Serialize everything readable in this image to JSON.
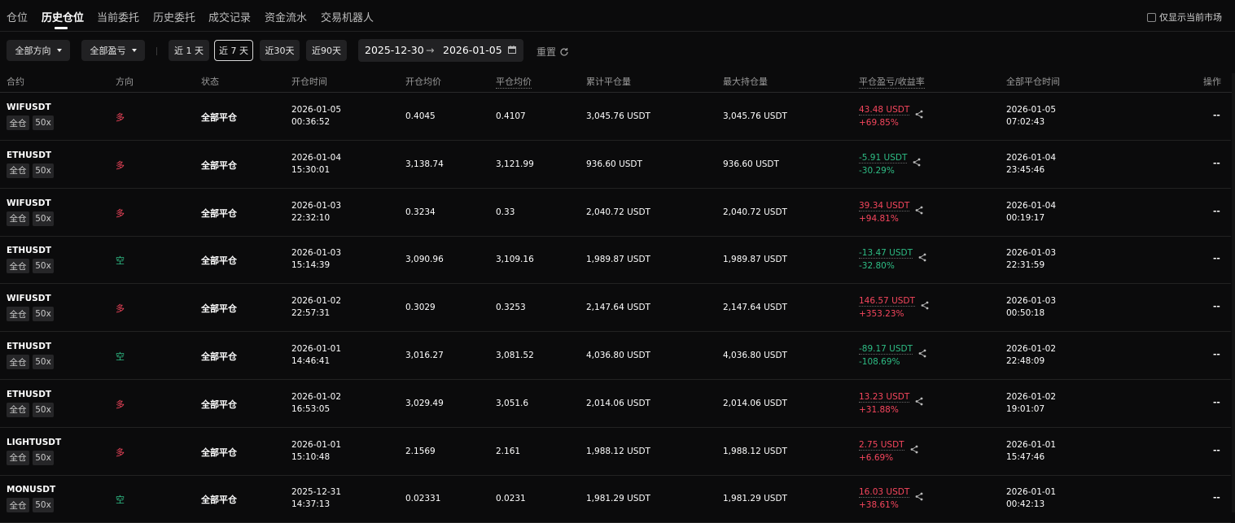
{
  "tabs": [
    "仓位",
    "历史仓位",
    "当前委托",
    "历史委托",
    "成交记录",
    "资金流水",
    "交易机器人"
  ],
  "active_tab": "历史仓位",
  "only_current_label": "仅显示当前市场",
  "filters": {
    "direction": "全部方向",
    "pnl": "全部盈亏",
    "ranges": [
      "近 1 天",
      "近 7 天",
      "近30天",
      "近90天"
    ],
    "selected_range": "近 7 天",
    "date_start": "2025-12-30",
    "date_arrow": "→",
    "date_end": "2026-01-05",
    "reset": "重置"
  },
  "columns": [
    "合约",
    "方向",
    "状态",
    "开仓时间",
    "开仓均价",
    "平仓均价",
    "累计平仓量",
    "最大持仓量",
    "平仓盈亏/收益率",
    "全部平仓时间",
    "操作"
  ],
  "rows": [
    {
      "symbol": "WIFUSDT",
      "margin": "全仓",
      "leverage": "50x",
      "direction": "多",
      "dir_type": "long",
      "status": "全部平仓",
      "open_date": "2026-01-05",
      "open_time": "00:36:52",
      "open_price": "0.4045",
      "close_price": "0.4107",
      "closed_vol": "3,045.76 USDT",
      "max_pos": "3,045.76 USDT",
      "pnl": "43.48 USDT",
      "roi": "+69.85%",
      "pnl_sign": "up",
      "close_date": "2026-01-05",
      "close_time": "07:02:43",
      "ops": "--"
    },
    {
      "symbol": "ETHUSDT",
      "margin": "全仓",
      "leverage": "50x",
      "direction": "多",
      "dir_type": "long",
      "status": "全部平仓",
      "open_date": "2026-01-04",
      "open_time": "15:30:01",
      "open_price": "3,138.74",
      "close_price": "3,121.99",
      "closed_vol": "936.60 USDT",
      "max_pos": "936.60 USDT",
      "pnl": "-5.91 USDT",
      "roi": "-30.29%",
      "pnl_sign": "dn",
      "close_date": "2026-01-04",
      "close_time": "23:45:46",
      "ops": "--"
    },
    {
      "symbol": "WIFUSDT",
      "margin": "全仓",
      "leverage": "50x",
      "direction": "多",
      "dir_type": "long",
      "status": "全部平仓",
      "open_date": "2026-01-03",
      "open_time": "22:32:10",
      "open_price": "0.3234",
      "close_price": "0.33",
      "closed_vol": "2,040.72 USDT",
      "max_pos": "2,040.72 USDT",
      "pnl": "39.34 USDT",
      "roi": "+94.81%",
      "pnl_sign": "up",
      "close_date": "2026-01-04",
      "close_time": "00:19:17",
      "ops": "--"
    },
    {
      "symbol": "ETHUSDT",
      "margin": "全仓",
      "leverage": "50x",
      "direction": "空",
      "dir_type": "short",
      "status": "全部平仓",
      "open_date": "2026-01-03",
      "open_time": "15:14:39",
      "open_price": "3,090.96",
      "close_price": "3,109.16",
      "closed_vol": "1,989.87 USDT",
      "max_pos": "1,989.87 USDT",
      "pnl": "-13.47 USDT",
      "roi": "-32.80%",
      "pnl_sign": "dn",
      "close_date": "2026-01-03",
      "close_time": "22:31:59",
      "ops": "--"
    },
    {
      "symbol": "WIFUSDT",
      "margin": "全仓",
      "leverage": "50x",
      "direction": "多",
      "dir_type": "long",
      "status": "全部平仓",
      "open_date": "2026-01-02",
      "open_time": "22:57:31",
      "open_price": "0.3029",
      "close_price": "0.3253",
      "closed_vol": "2,147.64 USDT",
      "max_pos": "2,147.64 USDT",
      "pnl": "146.57 USDT",
      "roi": "+353.23%",
      "pnl_sign": "up",
      "close_date": "2026-01-03",
      "close_time": "00:50:18",
      "ops": "--"
    },
    {
      "symbol": "ETHUSDT",
      "margin": "全仓",
      "leverage": "50x",
      "direction": "空",
      "dir_type": "short",
      "status": "全部平仓",
      "open_date": "2026-01-01",
      "open_time": "14:46:41",
      "open_price": "3,016.27",
      "close_price": "3,081.52",
      "closed_vol": "4,036.80 USDT",
      "max_pos": "4,036.80 USDT",
      "pnl": "-89.17 USDT",
      "roi": "-108.69%",
      "pnl_sign": "dn",
      "close_date": "2026-01-02",
      "close_time": "22:48:09",
      "ops": "--"
    },
    {
      "symbol": "ETHUSDT",
      "margin": "全仓",
      "leverage": "50x",
      "direction": "多",
      "dir_type": "long",
      "status": "全部平仓",
      "open_date": "2026-01-02",
      "open_time": "16:53:05",
      "open_price": "3,029.49",
      "close_price": "3,051.6",
      "closed_vol": "2,014.06 USDT",
      "max_pos": "2,014.06 USDT",
      "pnl": "13.23 USDT",
      "roi": "+31.88%",
      "pnl_sign": "up",
      "close_date": "2026-01-02",
      "close_time": "19:01:07",
      "ops": "--"
    },
    {
      "symbol": "LIGHTUSDT",
      "margin": "全仓",
      "leverage": "50x",
      "direction": "多",
      "dir_type": "long",
      "status": "全部平仓",
      "open_date": "2026-01-01",
      "open_time": "15:10:48",
      "open_price": "2.1569",
      "close_price": "2.161",
      "closed_vol": "1,988.12 USDT",
      "max_pos": "1,988.12 USDT",
      "pnl": "2.75 USDT",
      "roi": "+6.69%",
      "pnl_sign": "up",
      "close_date": "2026-01-01",
      "close_time": "15:47:46",
      "ops": "--"
    },
    {
      "symbol": "MONUSDT",
      "margin": "全仓",
      "leverage": "50x",
      "direction": "空",
      "dir_type": "short",
      "status": "全部平仓",
      "open_date": "2025-12-31",
      "open_time": "14:37:13",
      "open_price": "0.02331",
      "close_price": "0.0231",
      "closed_vol": "1,981.29 USDT",
      "max_pos": "1,981.29 USDT",
      "pnl": "16.03 USDT",
      "roi": "+38.61%",
      "pnl_sign": "up",
      "close_date": "2026-01-01",
      "close_time": "00:42:13",
      "ops": "--"
    }
  ]
}
